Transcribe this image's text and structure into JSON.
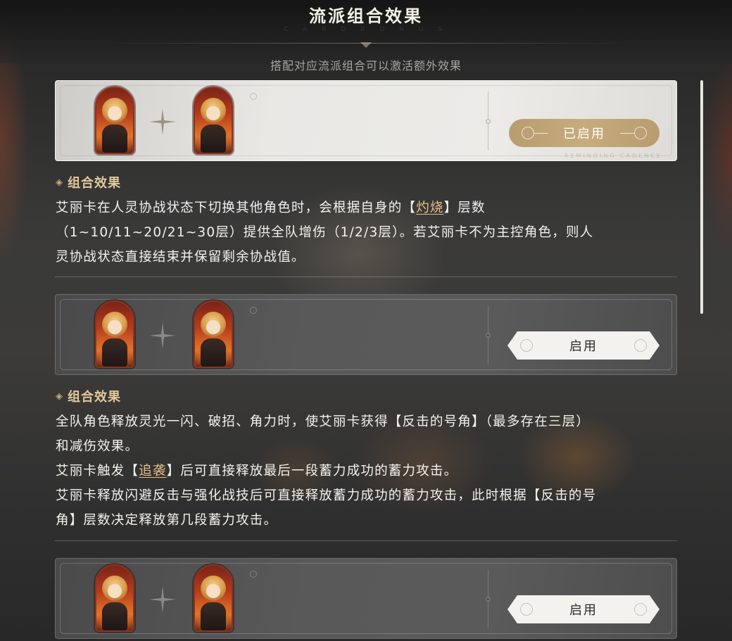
{
  "header": {
    "title": "流派组合效果",
    "title_sub": "C A R D   B O N U S",
    "subtitle": "搭配对应流派组合可以激活额外效果"
  },
  "cards": [
    {
      "state": "active",
      "button_label": "已启用",
      "watermark": "REMINDING CADENCE",
      "effect_heading": "组合效果",
      "effect_lines": [
        [
          "艾丽卡在人灵协战状态下切换其他角色时，会根据自身的【",
          {
            "kw": "灼烧"
          },
          "】层数"
        ],
        [
          "（1~10/11~20/21~30层）提供全队增伤（1/2/3层）。若艾丽卡不为主控角色，则人"
        ],
        [
          "灵协战状态直接结束并保留剩余协战值。"
        ]
      ]
    },
    {
      "state": "inactive",
      "button_label": "启用",
      "effect_heading": "组合效果",
      "effect_lines": [
        [
          "全队角色释放灵光一闪、破招、角力时，使艾丽卡获得【反击的号角】（最多存在三层）"
        ],
        [
          "和减伤效果。"
        ],
        [
          "艾丽卡触发【",
          {
            "kw": "追袭"
          },
          "】后可直接释放最后一段蓄力成功的蓄力攻击。"
        ],
        [
          "艾丽卡释放闪避反击与强化战技后可直接释放蓄力成功的蓄力攻击，此时根据【反击的号"
        ],
        [
          "角】层数决定释放第几段蓄力攻击。"
        ]
      ]
    },
    {
      "state": "inactive",
      "button_label": "启用"
    }
  ],
  "icons": {
    "plus": "four-point-star-icon",
    "heading_marker": "diamond-icon"
  },
  "colors": {
    "gold": "#e2c79a",
    "keyword": "#e7c287",
    "active_button": "#c6ab7d"
  }
}
